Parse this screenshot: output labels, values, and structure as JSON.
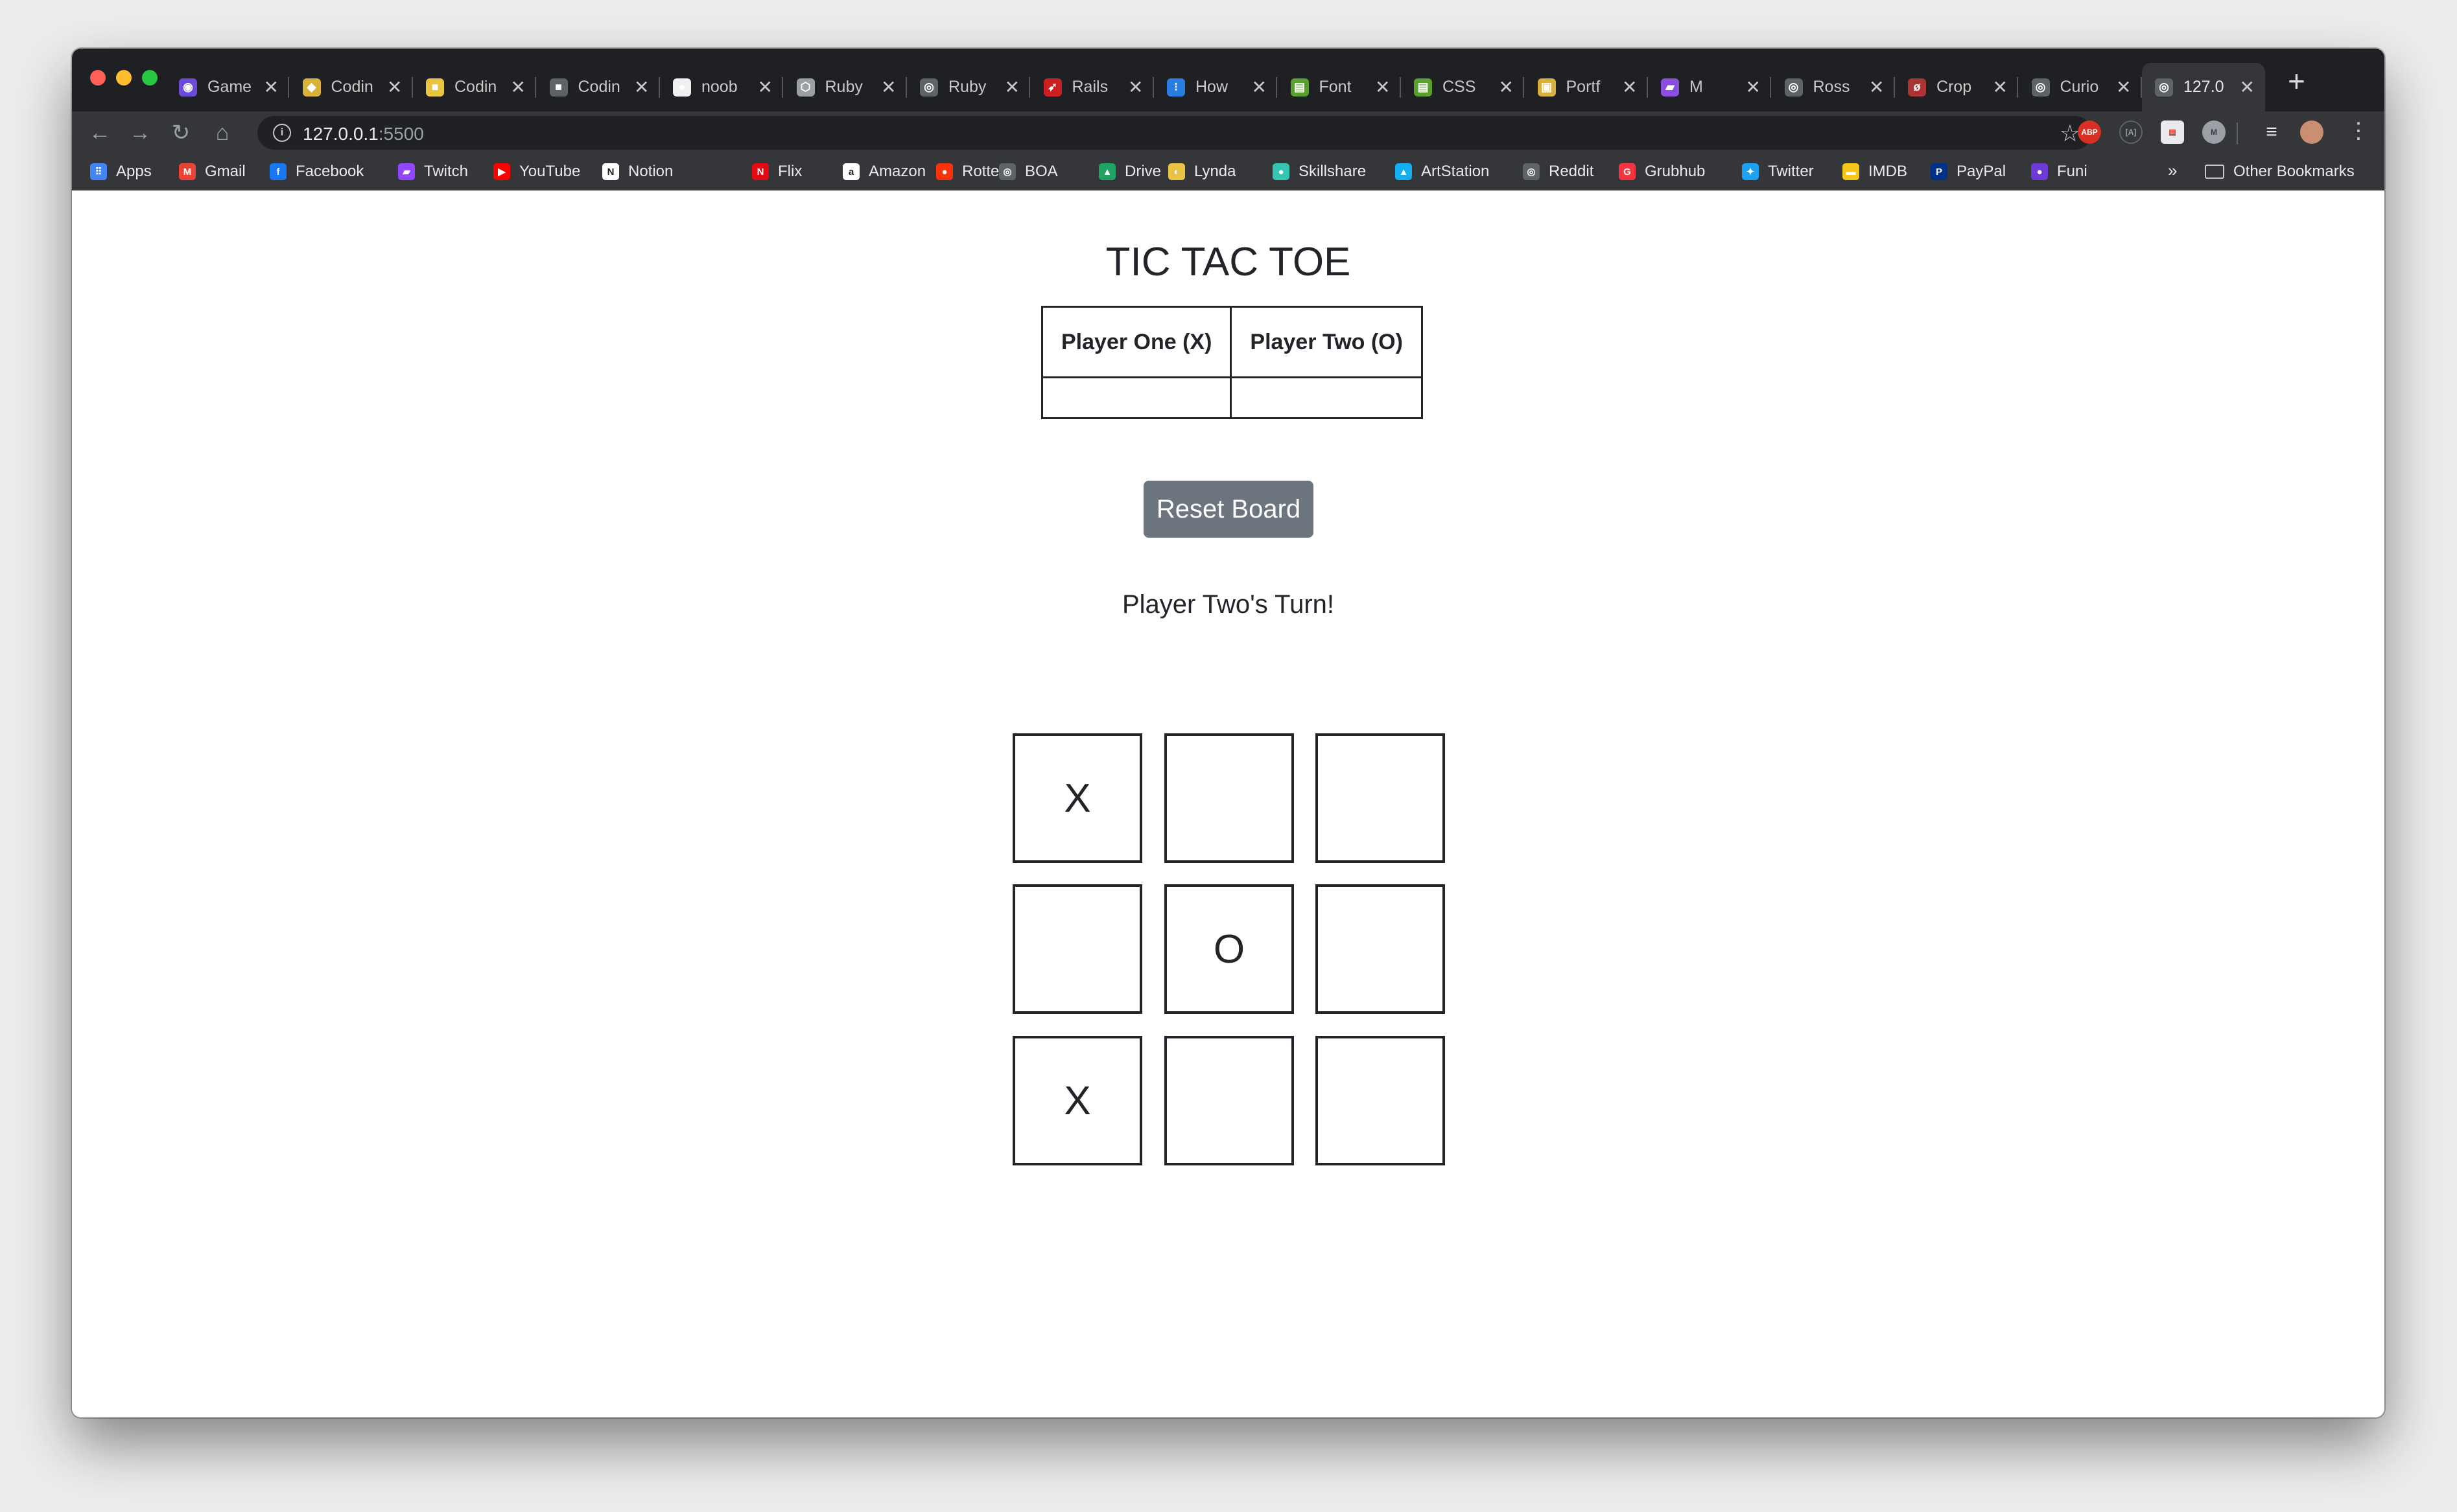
{
  "browser": {
    "tabs": [
      {
        "title": "Game",
        "fav_color": "#6b4bd8",
        "fav_glyph": "◉"
      },
      {
        "title": "Codin",
        "fav_color": "#d9b23a",
        "fav_glyph": "◆"
      },
      {
        "title": "Codin",
        "fav_color": "#e8c440",
        "fav_glyph": "■"
      },
      {
        "title": "Codin",
        "fav_color": "#5f6368",
        "fav_glyph": "■"
      },
      {
        "title": "noob",
        "fav_color": "#f0f0f0",
        "fav_glyph": "●"
      },
      {
        "title": "Ruby",
        "fav_color": "#9aa0a6",
        "fav_glyph": "⬡"
      },
      {
        "title": "Ruby",
        "fav_color": "#5f6368",
        "fav_glyph": "◎"
      },
      {
        "title": "Rails",
        "fav_color": "#cc1f1f",
        "fav_glyph": "➶"
      },
      {
        "title": "How",
        "fav_color": "#2a7de1",
        "fav_glyph": "⁝"
      },
      {
        "title": "Font",
        "fav_color": "#5aa02c",
        "fav_glyph": "▤"
      },
      {
        "title": "CSS",
        "fav_color": "#5aa02c",
        "fav_glyph": "▤"
      },
      {
        "title": "Portf",
        "fav_color": "#d8b03c",
        "fav_glyph": "▣"
      },
      {
        "title": "M",
        "fav_color": "#8a4fe0",
        "fav_glyph": "▰"
      },
      {
        "title": "Ross",
        "fav_color": "#5f6368",
        "fav_glyph": "◎"
      },
      {
        "title": "Crop",
        "fav_color": "#a33",
        "fav_glyph": "ø"
      },
      {
        "title": "Curio",
        "fav_color": "#5f6368",
        "fav_glyph": "◎"
      },
      {
        "title": "127.0",
        "fav_color": "#5f6368",
        "fav_glyph": "◎"
      }
    ],
    "new_tab_glyph": "+",
    "address": {
      "host": "127.0.0.1",
      "port": ":5500"
    },
    "bookmarks": [
      {
        "label": "Apps",
        "color": "#4285f4",
        "glyph": "⠿"
      },
      {
        "label": "Gmail",
        "color": "#ea4335",
        "glyph": "M"
      },
      {
        "label": "Facebook",
        "color": "#1877f2",
        "glyph": "f"
      },
      {
        "label": "Twitch",
        "color": "#9146ff",
        "glyph": "▰"
      },
      {
        "label": "YouTube",
        "color": "#ff0000",
        "glyph": "▶"
      },
      {
        "label": "Notion",
        "color": "#ffffff",
        "glyph": "N"
      },
      {
        "label": "Flix",
        "color": "#e50914",
        "glyph": "N"
      },
      {
        "label": "Amazon",
        "color": "#ffffff",
        "glyph": "a"
      },
      {
        "label": "Rotten",
        "color": "#fa320a",
        "glyph": "●"
      },
      {
        "label": "BOA",
        "color": "#5f6368",
        "glyph": "◎"
      },
      {
        "label": "Drive",
        "color": "#1fa463",
        "glyph": "▲"
      },
      {
        "label": "Lynda",
        "color": "#e8c440",
        "glyph": "◐"
      },
      {
        "label": "Skillshare",
        "color": "#35c5b5",
        "glyph": "●"
      },
      {
        "label": "ArtStation",
        "color": "#13aff0",
        "glyph": "▲"
      },
      {
        "label": "Reddit",
        "color": "#5f6368",
        "glyph": "◎"
      },
      {
        "label": "Grubhub",
        "color": "#f63440",
        "glyph": "G"
      },
      {
        "label": "Twitter",
        "color": "#1da1f2",
        "glyph": "✦"
      },
      {
        "label": "IMDB",
        "color": "#f5c518",
        "glyph": "▬"
      },
      {
        "label": "PayPal",
        "color": "#003087",
        "glyph": "P"
      },
      {
        "label": "Funi",
        "color": "#6f3ad8",
        "glyph": "●"
      }
    ],
    "bookmarks_overflow": "»",
    "other_bookmarks": "Other Bookmarks"
  },
  "game": {
    "title": "TIC TAC TOE",
    "scoreboard": {
      "headers": [
        "Player One (X)",
        "Player Two (O)"
      ],
      "scores": [
        "",
        ""
      ]
    },
    "reset_label": "Reset Board",
    "status": "Player Two's Turn!",
    "board": [
      "X",
      "",
      "",
      "",
      "O",
      "",
      "X",
      "",
      ""
    ]
  }
}
